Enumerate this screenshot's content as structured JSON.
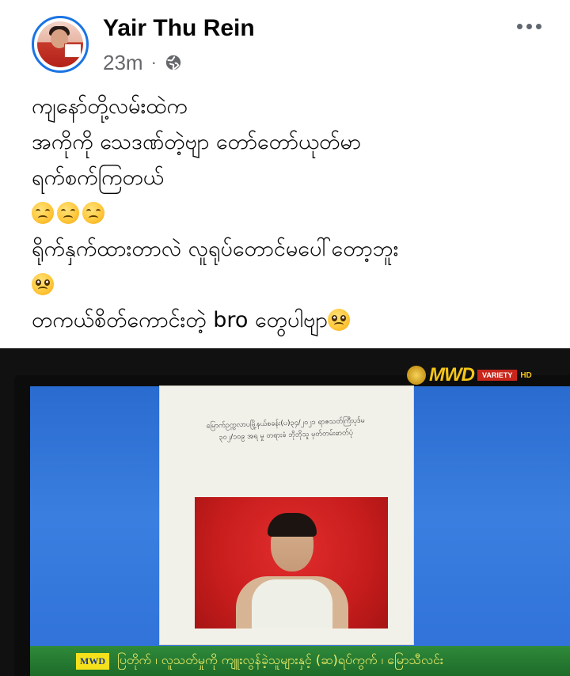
{
  "author": {
    "name": "Yair Thu Rein",
    "time": "23m",
    "separator": "·",
    "privacy_icon": "globe-icon"
  },
  "menu": {
    "icon": "more-horizontal-icon"
  },
  "post": {
    "lines": [
      "ကျနော်တို့လမ်းထဲက",
      "အကိုကို သေဒဏ်တဲ့ဗျာ တော်တော်ယုတ်မာ",
      "ရက်စက်ကြတယ်",
      "ရိုက်နှက်ထားတာလဲ လူရုပ်တောင်မပေါ်တော့ဘူး",
      "တကယ်စိတ်ကောင်းတဲ့ bro တွေပါဗျာ"
    ],
    "emoji": {
      "tired_face": "tired-face-emoji",
      "pleading_face": "pleading-face-emoji"
    }
  },
  "photo": {
    "doc_text": [
      "မြောက်ဥက္ကလာပမြို့နယ်စခန်း(ပ)၃၄/၂၀၂၁ ရာဇသတ်ကြီးပုဒ်မ",
      "၃၀၂/၁၀၉ အရ မှု တရားခံ ဘိုဘိုသူ မှတ်တမ်းဓာတ်ပုံ"
    ],
    "brand": {
      "logo_text": "MWD",
      "sub_text": "VARIETY",
      "hd_text": "HD"
    },
    "ticker": {
      "badge": "MWD",
      "text": "ပြတိုက် ၊ လူသတ်မှုကို ကျူးလွန်ခဲ့သူများနှင့် (ဆ)ရပ်ကွက် ၊ မြောသီလင်း"
    }
  },
  "colors": {
    "name": "#050505",
    "meta": "#65676b",
    "avatar_ring": "#1b74e4",
    "screen_blue": "#2f70d8",
    "ticker_green": "#1d6b29",
    "ticker_text": "#f9f36a"
  }
}
